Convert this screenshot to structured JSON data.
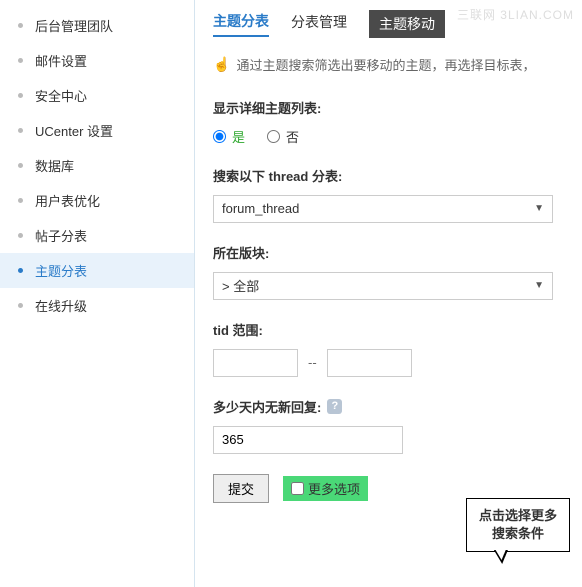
{
  "watermark": "三联网 3LIAN.COM",
  "sidebar": {
    "items": [
      {
        "label": "后台管理团队"
      },
      {
        "label": "邮件设置"
      },
      {
        "label": "安全中心"
      },
      {
        "label": "UCenter 设置"
      },
      {
        "label": "数据库"
      },
      {
        "label": "用户表优化"
      },
      {
        "label": "帖子分表"
      },
      {
        "label": "主题分表"
      },
      {
        "label": "在线升级"
      }
    ]
  },
  "tabs": {
    "tab1": "主题分表",
    "tab2": "分表管理",
    "tab3": "主题移动"
  },
  "hint": "通过主题搜索筛选出要移动的主题，再选择目标表，",
  "fields": {
    "show_detail_label": "显示详细主题列表:",
    "radio_yes": "是",
    "radio_no": "否",
    "search_thread_label": "搜索以下 thread 分表:",
    "search_thread_value": "forum_thread",
    "forum_label": "所在版块:",
    "forum_value": "> 全部",
    "tid_label": "tid 范围:",
    "tid_from": "",
    "tid_to": "",
    "range_sep": "--",
    "noreply_label": "多少天内无新回复:",
    "noreply_value": "365"
  },
  "buttons": {
    "submit": "提交",
    "more_options": "更多选项"
  },
  "callout": {
    "line1": "点击选择更多",
    "line2": "搜索条件"
  }
}
